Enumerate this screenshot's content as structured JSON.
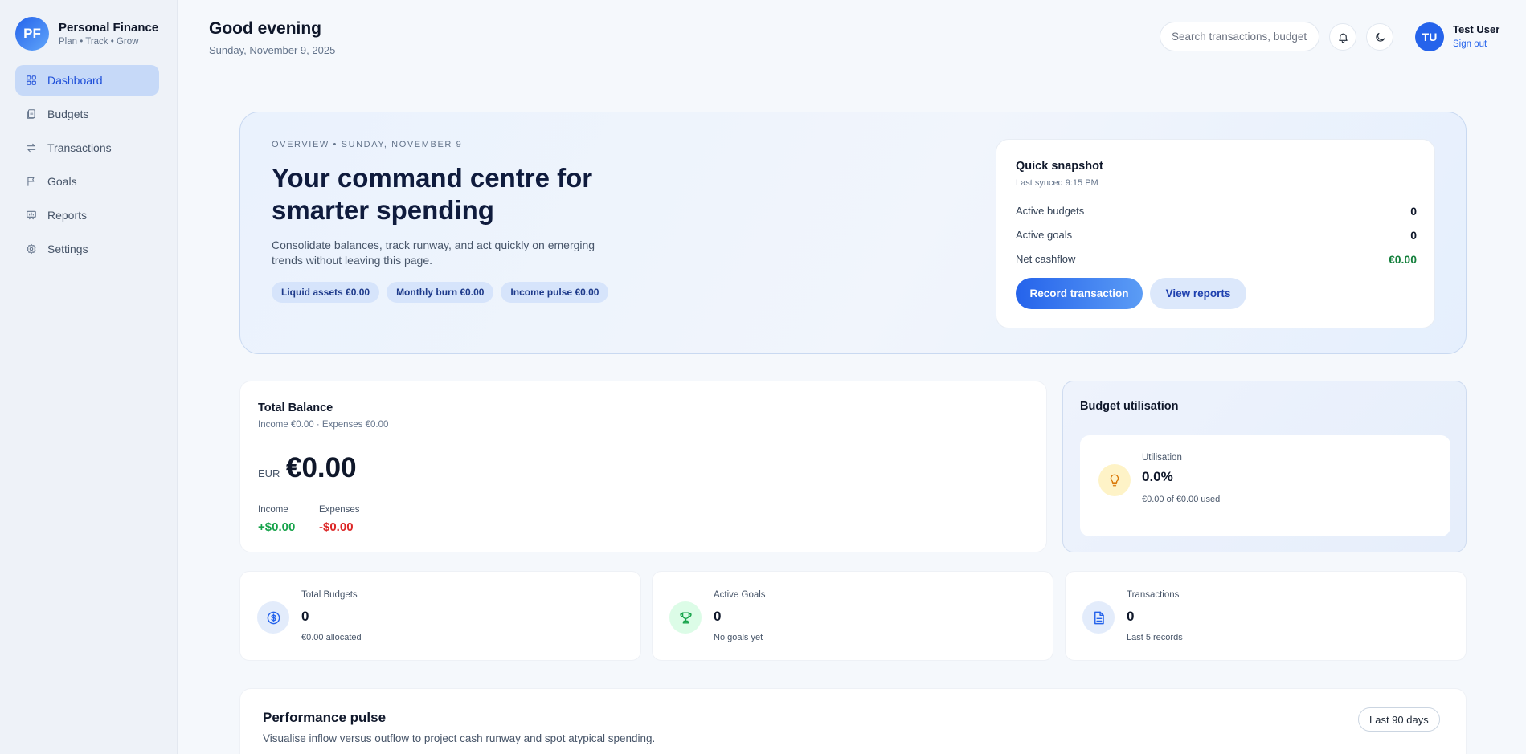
{
  "brand": {
    "initials": "PF",
    "name": "Personal Finance",
    "tagline": "Plan • Track • Grow"
  },
  "sidebar": {
    "items": [
      {
        "label": "Dashboard",
        "icon": "dashboard-icon",
        "active": true
      },
      {
        "label": "Budgets",
        "icon": "budget-icon"
      },
      {
        "label": "Transactions",
        "icon": "transfer-icon"
      },
      {
        "label": "Goals",
        "icon": "flag-icon"
      },
      {
        "label": "Reports",
        "icon": "report-icon"
      },
      {
        "label": "Settings",
        "icon": "gear-icon"
      }
    ]
  },
  "header": {
    "greeting": "Good evening",
    "date": "Sunday, November 9, 2025",
    "search_placeholder": "Search transactions, budgets",
    "user": {
      "initials": "TU",
      "name": "Test User",
      "signout": "Sign out"
    }
  },
  "hero": {
    "eyebrow": "OVERVIEW • SUNDAY, NOVEMBER 9",
    "title": "Your command centre for smarter spending",
    "description": "Consolidate balances, track runway, and act quickly on emerging trends without leaving this page.",
    "pills": [
      "Liquid assets €0.00",
      "Monthly burn €0.00",
      "Income pulse €0.00"
    ],
    "snapshot": {
      "title": "Quick snapshot",
      "subtitle": "Last synced 9:15 PM",
      "rows": [
        {
          "label": "Active budgets",
          "value": "0"
        },
        {
          "label": "Active goals",
          "value": "0"
        },
        {
          "label": "Net cashflow",
          "value": "€0.00"
        }
      ],
      "primary_button": "Record transaction",
      "secondary_button": "View reports"
    }
  },
  "balance": {
    "title": "Total Balance",
    "subtitle": "Income €0.00 · Expenses €0.00",
    "currency": "EUR",
    "amount": "€0.00",
    "income_label": "Income",
    "income_value": "+$0.00",
    "expenses_label": "Expenses",
    "expenses_value": "-$0.00"
  },
  "utilisation": {
    "title": "Budget utilisation",
    "label": "Utilisation",
    "value": "0.0%",
    "detail": "€0.00 of €0.00 used",
    "icon": "lightbulb-icon"
  },
  "stats": [
    {
      "label": "Total Budgets",
      "value": "0",
      "sub": "€0.00 allocated",
      "icon": "dollar-icon",
      "color": "#2563eb",
      "bg": "#e3ecfb"
    },
    {
      "label": "Active Goals",
      "value": "0",
      "sub": "No goals yet",
      "icon": "trophy-icon",
      "color": "#16a34a",
      "bg": "#dcfce7"
    },
    {
      "label": "Transactions",
      "value": "0",
      "sub": "Last 5 records",
      "icon": "document-icon",
      "color": "#2563eb",
      "bg": "#e3ecfb"
    }
  ],
  "performance": {
    "title": "Performance pulse",
    "subtitle": "Visualise inflow versus outflow to project cash runway and spot atypical spending.",
    "range": "Last 90 days"
  }
}
